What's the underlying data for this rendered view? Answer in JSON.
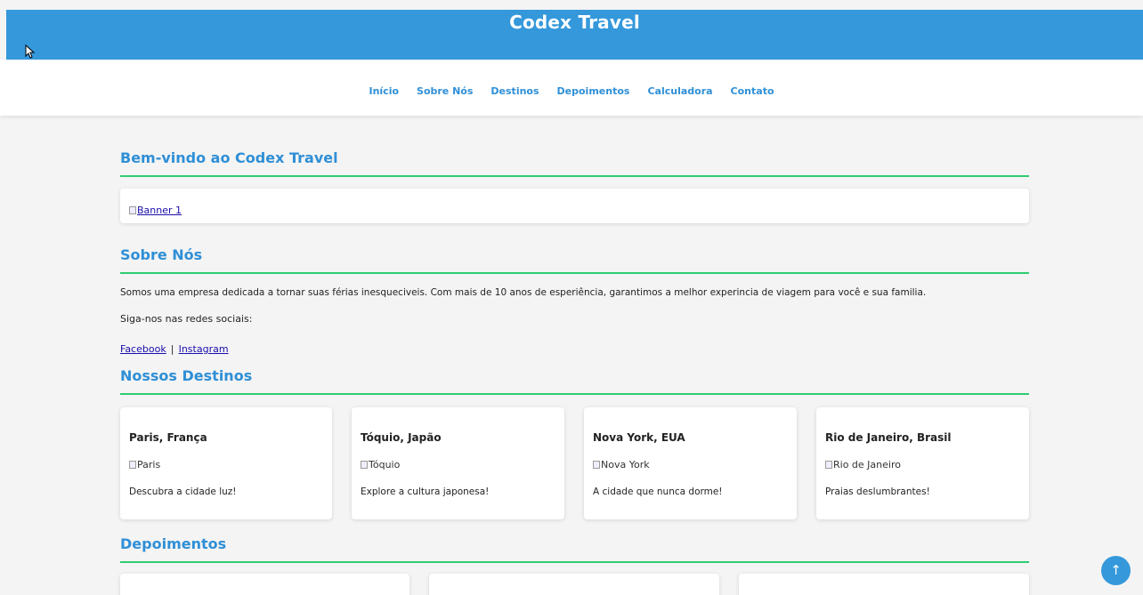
{
  "header": {
    "title": "Codex Travel"
  },
  "nav": {
    "items": [
      {
        "label": "Início"
      },
      {
        "label": "Sobre Nós"
      },
      {
        "label": "Destinos"
      },
      {
        "label": "Depoimentos"
      },
      {
        "label": "Calculadora"
      },
      {
        "label": "Contato"
      }
    ]
  },
  "welcome": {
    "title": "Bem-vindo ao Codex Travel",
    "banner_alt": "Banner 1"
  },
  "about": {
    "title": "Sobre Nós",
    "text": "Somos uma empresa dedicada a tornar suas férias inesqueciveis. Com mais de 10 anos de esperiência, garantimos a melhor experincia de viagem para você e sua familia.",
    "follow_text": "Siga-nos nas redes sociais:",
    "facebook": "Facebook",
    "separator": "|",
    "instagram": "Instagram"
  },
  "destinations": {
    "title": "Nossos Destinos",
    "items": [
      {
        "name": "Paris, França",
        "img_alt": "Paris",
        "desc": "Descubra a cidade luz!"
      },
      {
        "name": "Tóquio, Japão",
        "img_alt": "Tóquio",
        "desc": "Explore a cultura japonesa!"
      },
      {
        "name": "Nova York, EUA",
        "img_alt": "Nova York",
        "desc": "A cidade que nunca dorme!"
      },
      {
        "name": "Rio de Janeiro, Brasil",
        "img_alt": "Rio de Janeiro",
        "desc": "Praias deslumbrantes!"
      }
    ]
  },
  "testimonials": {
    "title": "Depoimentos"
  },
  "scroll_top": {
    "icon": "arrow-up-icon",
    "glyph": "↑"
  },
  "colors": {
    "header_bg": "#3498db",
    "accent": "#2f8fd6",
    "divider": "#2ecc71",
    "page_bg": "#f4f4f4"
  }
}
